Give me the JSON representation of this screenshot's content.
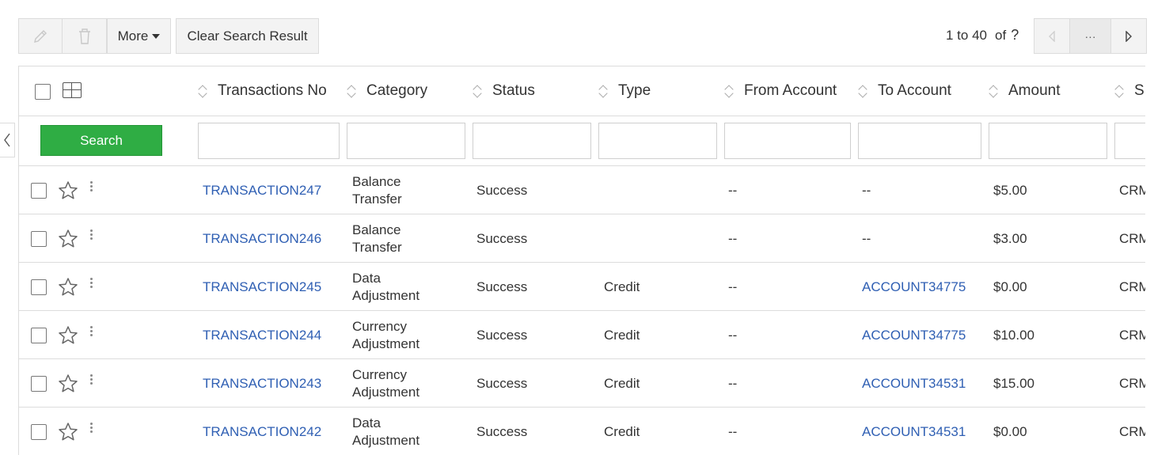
{
  "toolbar": {
    "edit_icon": "pencil-icon",
    "delete_icon": "trash-icon",
    "more_label": "More",
    "clear_label": "Clear Search Result"
  },
  "pagination": {
    "range": "1 to 40",
    "of_label": "of",
    "total_unknown": "?",
    "prev_icon": "triangle-left-icon",
    "more_label": "···",
    "next_icon": "triangle-right-icon"
  },
  "filter": {
    "search_label": "Search"
  },
  "columns": [
    {
      "label": "Transactions No"
    },
    {
      "label": "Category"
    },
    {
      "label": "Status"
    },
    {
      "label": "Type"
    },
    {
      "label": "From Account"
    },
    {
      "label": "To Account"
    },
    {
      "label": "Amount"
    },
    {
      "label": "S"
    }
  ],
  "rows": [
    {
      "txn": "TRANSACTION247",
      "cat1": "Balance",
      "cat2": "Transfer",
      "status": "Success",
      "type": "",
      "from": "--",
      "to": "--",
      "to_link": false,
      "amount": "$5.00",
      "src": "CRM"
    },
    {
      "txn": "TRANSACTION246",
      "cat1": "Balance",
      "cat2": "Transfer",
      "status": "Success",
      "type": "",
      "from": "--",
      "to": "--",
      "to_link": false,
      "amount": "$3.00",
      "src": "CRM"
    },
    {
      "txn": "TRANSACTION245",
      "cat1": "Data",
      "cat2": "Adjustment",
      "status": "Success",
      "type": "Credit",
      "from": "--",
      "to": "ACCOUNT34775",
      "to_link": true,
      "amount": "$0.00",
      "src": "CRM"
    },
    {
      "txn": "TRANSACTION244",
      "cat1": "Currency",
      "cat2": "Adjustment",
      "status": "Success",
      "type": "Credit",
      "from": "--",
      "to": "ACCOUNT34775",
      "to_link": true,
      "amount": "$10.00",
      "src": "CRM"
    },
    {
      "txn": "TRANSACTION243",
      "cat1": "Currency",
      "cat2": "Adjustment",
      "status": "Success",
      "type": "Credit",
      "from": "--",
      "to": "ACCOUNT34531",
      "to_link": true,
      "amount": "$15.00",
      "src": "CRM"
    },
    {
      "txn": "TRANSACTION242",
      "cat1": "Data",
      "cat2": "Adjustment",
      "status": "Success",
      "type": "Credit",
      "from": "--",
      "to": "ACCOUNT34531",
      "to_link": true,
      "amount": "$0.00",
      "src": "CRM"
    }
  ],
  "colors": {
    "link": "#2f5fb3",
    "search_button": "#2fad44",
    "border": "#dcdcdc"
  }
}
